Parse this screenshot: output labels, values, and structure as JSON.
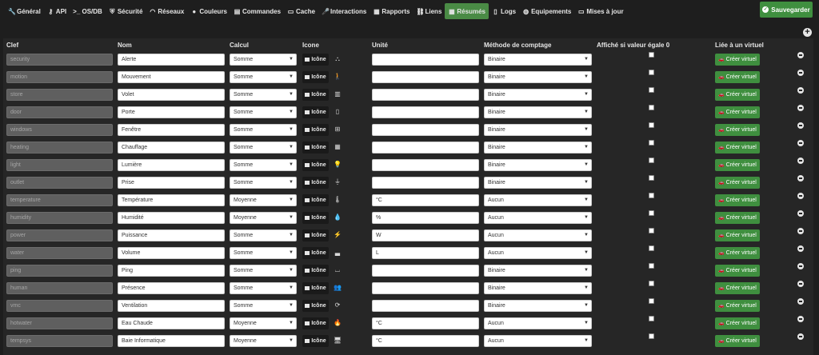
{
  "nav": {
    "tabs": [
      {
        "label": "Général",
        "icon": "wrench-icon",
        "glyph": "🔧",
        "active": false
      },
      {
        "label": "API",
        "icon": "key-icon",
        "glyph": "⚷",
        "active": false
      },
      {
        "label": ">_ OS/DB",
        "icon": "",
        "glyph": "",
        "active": false
      },
      {
        "label": "Sécurité",
        "icon": "shield-icon",
        "glyph": "⛨",
        "active": false
      },
      {
        "label": "Réseaux",
        "icon": "rss-icon",
        "glyph": "◠",
        "active": false
      },
      {
        "label": "Couleurs",
        "icon": "tint-icon",
        "glyph": "●",
        "active": false
      },
      {
        "label": "Commandes",
        "icon": "list-icon",
        "glyph": "▤",
        "active": false
      },
      {
        "label": "Cache",
        "icon": "hdd-icon",
        "glyph": "▭",
        "active": false
      },
      {
        "label": "Interactions",
        "icon": "microphone-icon",
        "glyph": "🎤",
        "active": false
      },
      {
        "label": "Rapports",
        "icon": "newspaper-icon",
        "glyph": "▦",
        "active": false
      },
      {
        "label": "Liens",
        "icon": "link-icon",
        "glyph": "⛓",
        "active": false
      },
      {
        "label": "Résumés",
        "icon": "table-icon",
        "glyph": "▦",
        "active": true
      },
      {
        "label": "Logs",
        "icon": "file-icon",
        "glyph": "▯",
        "active": false
      },
      {
        "label": "Equipements",
        "icon": "globe-icon",
        "glyph": "◍",
        "active": false
      },
      {
        "label": "Mises à jour",
        "icon": "window-icon",
        "glyph": "▭",
        "active": false
      }
    ],
    "save_label": "Sauvegarder"
  },
  "table": {
    "headers": {
      "key": "Clef",
      "name": "Nom",
      "calc": "Calcul",
      "icon": "Icone",
      "unit": "Unité",
      "mode": "Méthode de comptage",
      "zero": "Affiché si valeur égale 0",
      "virtual": "Liée à un virtuel"
    },
    "icon_button_label": "Icône",
    "virtual_button_label": "Créer virtuel",
    "rows": [
      {
        "key": "security",
        "name": "Alerte",
        "calc": "Somme",
        "icon": "alert-icon",
        "glyph": "⛬",
        "unit": "",
        "mode": "Binaire"
      },
      {
        "key": "motion",
        "name": "Mouvement",
        "calc": "Somme",
        "icon": "walking-icon",
        "glyph": "🚶",
        "unit": "",
        "mode": "Binaire"
      },
      {
        "key": "store",
        "name": "Volet",
        "calc": "Somme",
        "icon": "shutter-icon",
        "glyph": "▥",
        "unit": "",
        "mode": "Binaire"
      },
      {
        "key": "door",
        "name": "Porte",
        "calc": "Somme",
        "icon": "door-icon",
        "glyph": "▯",
        "unit": "",
        "mode": "Binaire"
      },
      {
        "key": "windows",
        "name": "Fenêtre",
        "calc": "Somme",
        "icon": "window-icon",
        "glyph": "⊞",
        "unit": "",
        "mode": "Binaire"
      },
      {
        "key": "heating",
        "name": "Chauffage",
        "calc": "Somme",
        "icon": "radiator-icon",
        "glyph": "▦",
        "unit": "",
        "mode": "Binaire"
      },
      {
        "key": "light",
        "name": "Lumière",
        "calc": "Somme",
        "icon": "lightbulb-icon",
        "glyph": "💡",
        "unit": "",
        "mode": "Binaire"
      },
      {
        "key": "outlet",
        "name": "Prise",
        "calc": "Somme",
        "icon": "plug-icon",
        "glyph": "⏚",
        "unit": "",
        "mode": "Binaire"
      },
      {
        "key": "temperature",
        "name": "Température",
        "calc": "Moyenne",
        "icon": "thermometer-icon",
        "glyph": "🌡",
        "unit": "°C",
        "mode": "Aucun"
      },
      {
        "key": "humidity",
        "name": "Humidité",
        "calc": "Moyenne",
        "icon": "drop-icon",
        "glyph": "💧",
        "unit": "%",
        "mode": "Aucun"
      },
      {
        "key": "power",
        "name": "Puissance",
        "calc": "Somme",
        "icon": "bolt-icon",
        "glyph": "⚡",
        "unit": "W",
        "mode": "Aucun"
      },
      {
        "key": "water",
        "name": "Volume",
        "calc": "Somme",
        "icon": "bathtub-icon",
        "glyph": "▃",
        "unit": "L",
        "mode": "Aucun"
      },
      {
        "key": "ping",
        "name": "Ping",
        "calc": "Somme",
        "icon": "sofa-icon",
        "glyph": "⌴",
        "unit": "",
        "mode": "Binaire"
      },
      {
        "key": "human",
        "name": "Présence",
        "calc": "Somme",
        "icon": "people-icon",
        "glyph": "👥",
        "unit": "",
        "mode": "Binaire"
      },
      {
        "key": "vmc",
        "name": "Ventilation",
        "calc": "Somme",
        "icon": "refresh-icon",
        "glyph": "⟳",
        "unit": "",
        "mode": "Binaire"
      },
      {
        "key": "hotwater",
        "name": "Eau Chaude",
        "calc": "Moyenne",
        "icon": "fire-icon",
        "glyph": "🔥",
        "unit": "°C",
        "mode": "Aucun"
      },
      {
        "key": "tempsys",
        "name": "Baie Informatique",
        "calc": "Moyenne",
        "icon": "server-icon",
        "glyph": "🖥",
        "unit": "°C",
        "mode": "Aucun"
      }
    ]
  },
  "colors": {
    "accent": "#3f8f3f",
    "active_tab": "#4a8b45",
    "background": "#1e1e1e",
    "panel": "#262626"
  }
}
